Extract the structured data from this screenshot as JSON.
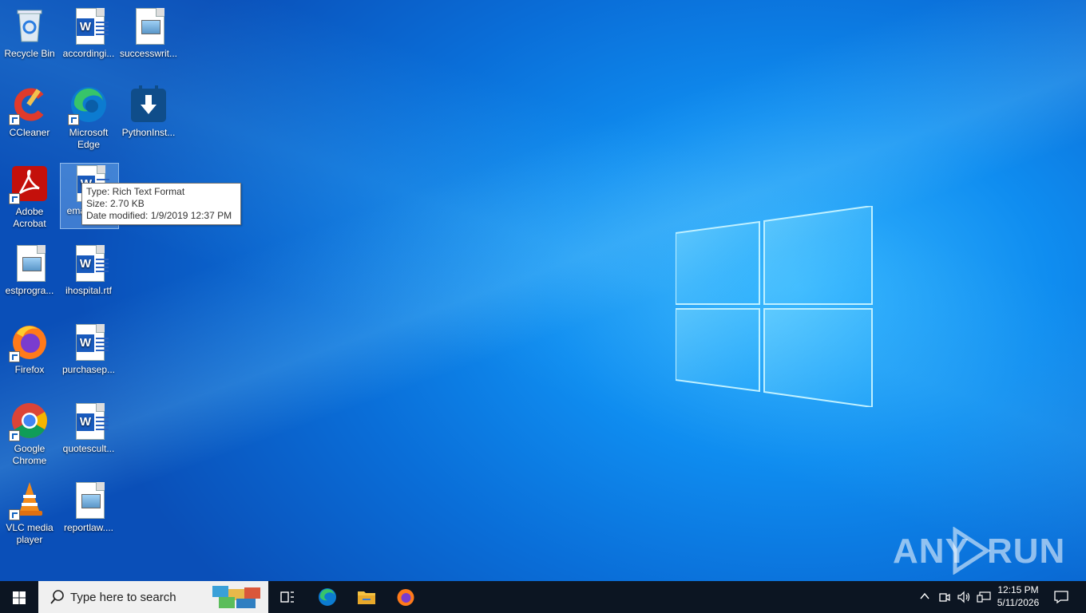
{
  "desktop": {
    "icons": [
      {
        "label": "Recycle Bin"
      },
      {
        "label": "accordingi..."
      },
      {
        "label": "successwrit..."
      },
      {
        "label": "CCleaner"
      },
      {
        "label": "Microsoft Edge"
      },
      {
        "label": "PythonInst..."
      },
      {
        "label": "Adobe Acrobat"
      },
      {
        "label": "emai...e.rtf"
      },
      {
        "label": "estprogra..."
      },
      {
        "label": "ihospital.rtf"
      },
      {
        "label": "Firefox"
      },
      {
        "label": "purchasep..."
      },
      {
        "label": "Google Chrome"
      },
      {
        "label": "quotescult..."
      },
      {
        "label": "VLC media player"
      },
      {
        "label": "reportlaw...."
      }
    ]
  },
  "tooltip": {
    "type": "Type: Rich Text Format",
    "size": "Size: 2.70 KB",
    "modified": "Date modified: 1/9/2019 12:37 PM"
  },
  "watermark": {
    "left": "ANY",
    "right": "RUN"
  },
  "taskbar": {
    "search_placeholder": "Type here to search",
    "clock_time": "12:15 PM",
    "clock_date": "5/11/2026"
  },
  "colors": {
    "taskbar": "#0c1522",
    "accent": "#0a78d7"
  }
}
